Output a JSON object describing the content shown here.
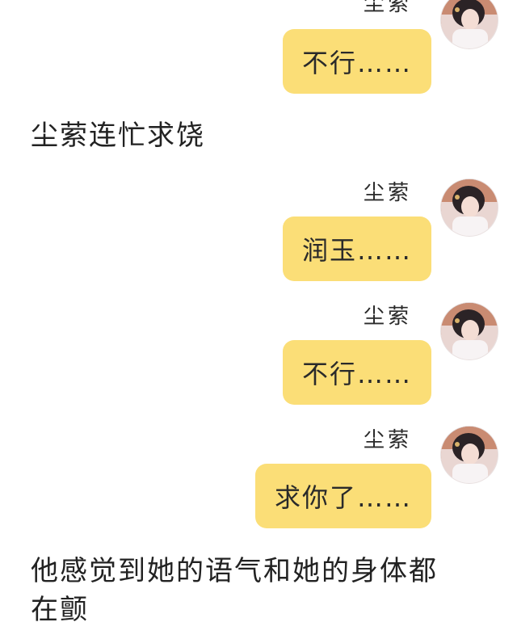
{
  "messages": [
    {
      "sender": "尘萦",
      "text": "不行……"
    },
    {
      "sender": "尘萦",
      "text": "润玉……"
    },
    {
      "sender": "尘萦",
      "text": "不行……"
    },
    {
      "sender": "尘萦",
      "text": "求你了……"
    }
  ],
  "narration": {
    "first": "尘萦连忙求饶",
    "second_line1": "他感觉到她的语气和她的身体都",
    "second_line2": "在颤"
  },
  "colors": {
    "bubble": "#fbde77",
    "background": "#ffffff"
  }
}
